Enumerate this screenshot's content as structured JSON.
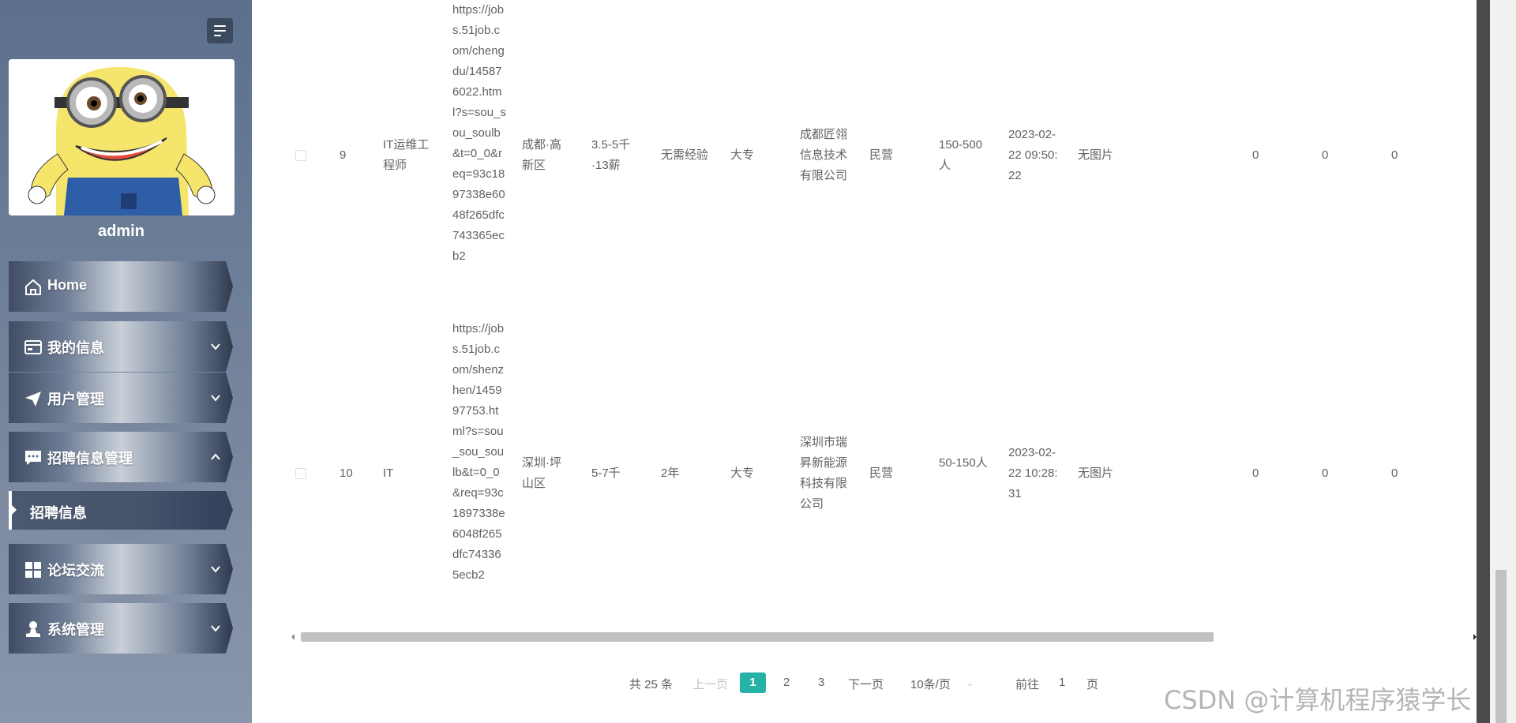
{
  "sidebar": {
    "username": "admin",
    "menu": [
      {
        "label": "Home",
        "icon": "home-icon",
        "expandable": false
      },
      {
        "label": "我的信息",
        "icon": "id-card-icon",
        "expandable": true,
        "expanded": false
      },
      {
        "label": "用户管理",
        "icon": "paper-plane-icon",
        "expandable": true,
        "expanded": false
      },
      {
        "label": "招聘信息管理",
        "icon": "chat-bubble-icon",
        "expandable": true,
        "expanded": true
      },
      {
        "label": "论坛交流",
        "icon": "grid-icon",
        "expandable": true,
        "expanded": false
      },
      {
        "label": "系统管理",
        "icon": "user-stamp-icon",
        "expandable": true,
        "expanded": false
      }
    ],
    "active_sub_item": "招聘信息"
  },
  "table": {
    "rows": [
      {
        "index": "9",
        "title": "IT运维工程师",
        "url": "https://jobs.51job.com/chengdu/145876022.html?s=sou_sou_soulb&t=0_0&req=93c1897338e6048f265dfc743365ecb2",
        "location": "成都·高新区",
        "salary": "3.5-5千·13薪",
        "experience": "无需经验",
        "education": "大专",
        "company": "成都匠翎信息技术有限公司",
        "company_type": "民营",
        "company_size": "150-500人",
        "time": "2023-02-22 09:50:22",
        "image": "无图片",
        "c1": "0",
        "c2": "0",
        "c3": "0"
      },
      {
        "index": "10",
        "title": "IT",
        "url": "https://jobs.51job.com/shenzhen/145997753.html?s=sou_sou_soulb&t=0_0&req=93c1897338e6048f265dfc743365ecb2",
        "location": "深圳·坪山区",
        "salary": "5-7千",
        "experience": "2年",
        "education": "大专",
        "company": "深圳市瑞昇新能源科技有限公司",
        "company_type": "民营",
        "company_size": "50-150人",
        "time": "2023-02-22 10:28:31",
        "image": "无图片",
        "c1": "0",
        "c2": "0",
        "c3": "0"
      }
    ]
  },
  "pager": {
    "total": "共 25 条",
    "prev": "上一页",
    "pages": [
      "1",
      "2",
      "3"
    ],
    "current": "1",
    "next": "下一页",
    "page_size": "10条/页",
    "goto_label": "前往",
    "goto_value": "1",
    "goto_suffix": "页"
  },
  "watermark": "CSDN @计算机程序猿学长",
  "colors": {
    "accent": "#25b3a8",
    "sidebar": "#6e7f99"
  }
}
